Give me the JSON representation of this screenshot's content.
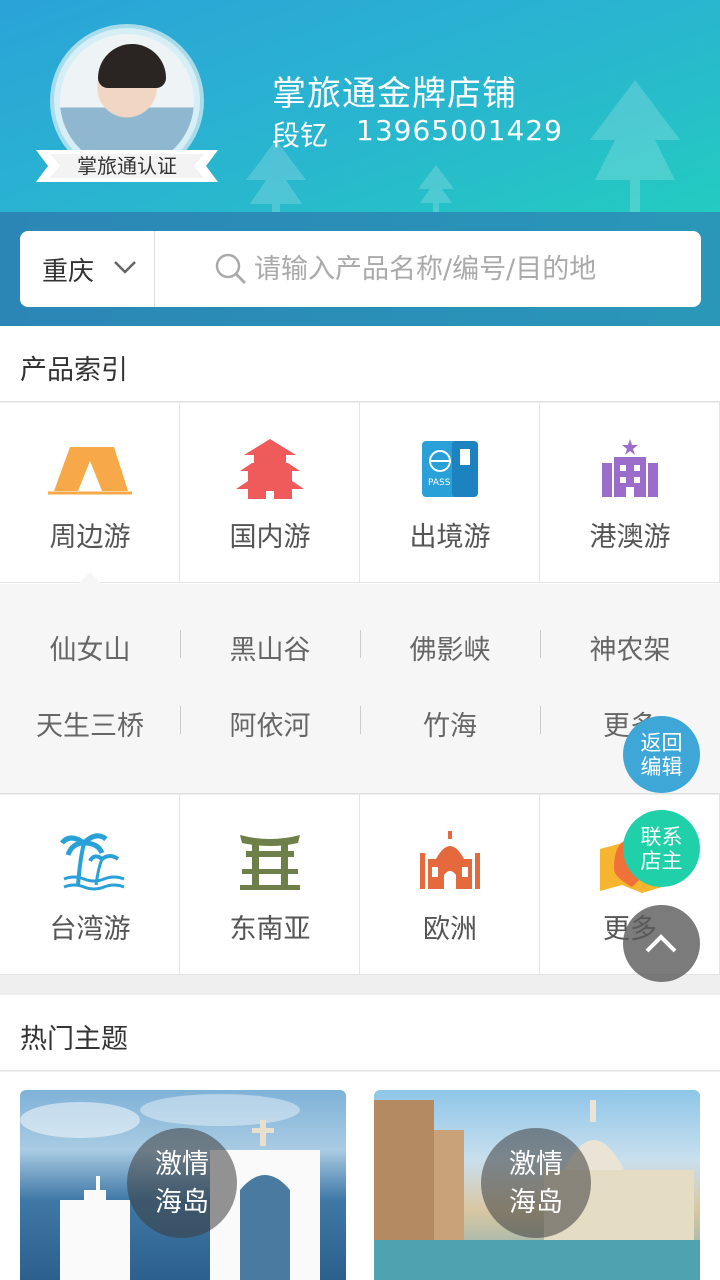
{
  "header": {
    "shop_title": "掌旅通金牌店铺",
    "owner": "段钇",
    "phone": "13965001429",
    "badge": "掌旅通认证"
  },
  "search": {
    "city": "重庆",
    "placeholder": "请输入产品名称/编号/目的地"
  },
  "product_index": {
    "title": "产品索引",
    "row1": [
      {
        "label": "周边游",
        "icon": "tent-icon"
      },
      {
        "label": "国内游",
        "icon": "pagoda-icon"
      },
      {
        "label": "出境游",
        "icon": "passport-icon"
      },
      {
        "label": "港澳游",
        "icon": "hotel-icon"
      }
    ],
    "sub_items": [
      "仙女山",
      "黑山谷",
      "佛影峡",
      "神农架",
      "天生三桥",
      "阿依河",
      "竹海",
      "更多"
    ],
    "row2": [
      {
        "label": "台湾游",
        "icon": "palm-island-icon"
      },
      {
        "label": "东南亚",
        "icon": "torii-icon"
      },
      {
        "label": "欧洲",
        "icon": "taj-mahal-icon"
      },
      {
        "label": "更多",
        "icon": "map-pin-icon"
      }
    ]
  },
  "hot_topics": {
    "title": "热门主题",
    "cards": [
      {
        "label_line1": "激情",
        "label_line2": "海岛"
      },
      {
        "label_line1": "激情",
        "label_line2": "海岛"
      }
    ]
  },
  "floating": {
    "edit_line1": "返回",
    "edit_line2": "编辑",
    "contact_line1": "联系",
    "contact_line2": "店主"
  },
  "colors": {
    "header_start": "#2aa3d8",
    "header_end": "#20d7b8",
    "fab_edit": "#3fa6d8",
    "fab_contact": "#1fd0a9"
  }
}
